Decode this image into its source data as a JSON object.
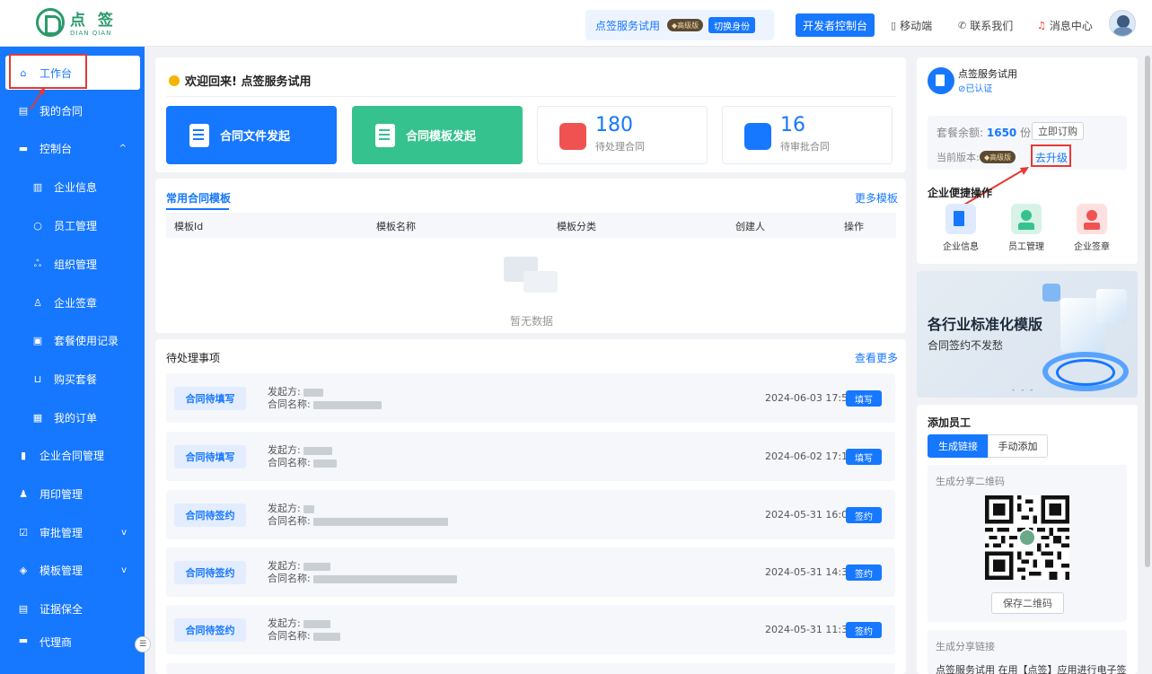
{
  "topbar": {
    "logo_cn": "点 签",
    "logo_en": "DIAN QIAN",
    "trial_name": "点签服务试用",
    "tier_badge": "高级版",
    "switch_identity": "切换身份",
    "dev_console": "开发者控制台",
    "mobile": "移动端",
    "contact": "联系我们",
    "messages": "消息中心"
  },
  "sidebar": {
    "items": [
      {
        "label": "工作台",
        "icon": "home-icon"
      },
      {
        "label": "我的合同",
        "icon": "contract-icon"
      },
      {
        "label": "控制台",
        "icon": "console-icon"
      },
      {
        "label": "企业信息",
        "icon": "building-icon"
      },
      {
        "label": "员工管理",
        "icon": "user-icon"
      },
      {
        "label": "组织管理",
        "icon": "org-tree-icon"
      },
      {
        "label": "企业签章",
        "icon": "seal-icon"
      },
      {
        "label": "套餐使用记录",
        "icon": "record-icon"
      },
      {
        "label": "购买套餐",
        "icon": "cart-icon"
      },
      {
        "label": "我的订单",
        "icon": "order-icon"
      },
      {
        "label": "企业合同管理",
        "icon": "file-icon"
      },
      {
        "label": "用印管理",
        "icon": "stamp-icon"
      },
      {
        "label": "审批管理",
        "icon": "check-icon"
      },
      {
        "label": "模板管理",
        "icon": "layers-icon"
      },
      {
        "label": "证据保全",
        "icon": "evidence-icon"
      },
      {
        "label": "代理商",
        "icon": "agent-icon"
      }
    ]
  },
  "welcome": {
    "title": "欢迎回来!  点签服务试用",
    "btn_file": "合同文件发起",
    "btn_template": "合同模板发起",
    "stat1_num": "180",
    "stat1_label": "待处理合同",
    "stat2_num": "16",
    "stat2_label": "待审批合同"
  },
  "templates": {
    "tab": "常用合同模板",
    "more": "更多模板",
    "columns": [
      "模板Id",
      "模板名称",
      "模板分类",
      "创建人",
      "操作"
    ],
    "empty": "暂无数据"
  },
  "todo": {
    "title": "待处理事项",
    "more": "查看更多",
    "initiator_label": "发起方:",
    "contract_label": "合同名称:",
    "rows": [
      {
        "tag": "合同待填写",
        "time": "2024-06-03 17:54",
        "action": "填写"
      },
      {
        "tag": "合同待填写",
        "time": "2024-06-02 17:18",
        "action": "填写"
      },
      {
        "tag": "合同待签约",
        "time": "2024-05-31 16:05",
        "action": "签约"
      },
      {
        "tag": "合同待签约",
        "time": "2024-05-31 14:36",
        "action": "签约"
      },
      {
        "tag": "合同待签约",
        "time": "2024-05-31 11:37",
        "action": "签约"
      }
    ]
  },
  "right": {
    "org_name": "点签服务试用",
    "verified": "已认证",
    "pkg_label": "套餐余额:",
    "pkg_value": "1650",
    "pkg_unit": "份",
    "order_now": "立即订购",
    "version_label": "当前版本:",
    "version_badge": "高级版",
    "upgrade": "去升级",
    "quick_title": "企业便捷操作",
    "quick": [
      "企业信息",
      "员工管理",
      "企业签章"
    ],
    "banner_title": "各行业标准化模版",
    "banner_sub": "合同签约不发愁",
    "add_staff": "添加员工",
    "tab_gen": "生成链接",
    "tab_manual": "手动添加",
    "qr_title": "生成分享二维码",
    "save_qr": "保存二维码",
    "link_title": "生成分享链接",
    "link_text": "点签服务试用 在用【点签】应用进行电子签"
  },
  "colors": {
    "primary": "#1677ff",
    "green": "#36c28f",
    "red": "#e53935"
  }
}
